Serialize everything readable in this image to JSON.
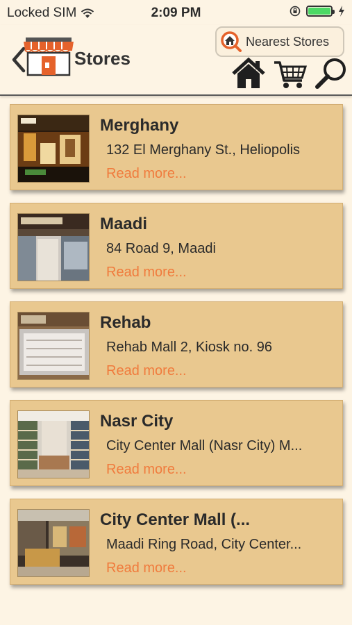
{
  "status_bar": {
    "carrier": "Locked SIM",
    "time": "2:09 PM"
  },
  "header": {
    "title": "Stores",
    "nearest_stores_label": "Nearest Stores",
    "icons": [
      "back-chevron-icon",
      "store-icon",
      "home-icon",
      "cart-icon",
      "search-icon"
    ]
  },
  "stores": [
    {
      "name": "Merghany",
      "address": "132 El Merghany St., Heliopolis",
      "read_more": "Read more..."
    },
    {
      "name": "Maadi",
      "address": "84 Road 9, Maadi",
      "read_more": "Read more..."
    },
    {
      "name": "Rehab",
      "address": "Rehab Mall 2, Kiosk no. 96",
      "read_more": "Read more..."
    },
    {
      "name": "Nasr City",
      "address": "City Center Mall (Nasr City) M...",
      "read_more": "Read more..."
    },
    {
      "name": "City Center Mall (...",
      "address": "Maadi Ring Road, City Center...",
      "read_more": "Read more..."
    }
  ],
  "colors": {
    "background": "#fdf4e4",
    "card": "#e9c88f",
    "link": "#f07b3d",
    "accent_orange": "#e5622b"
  }
}
